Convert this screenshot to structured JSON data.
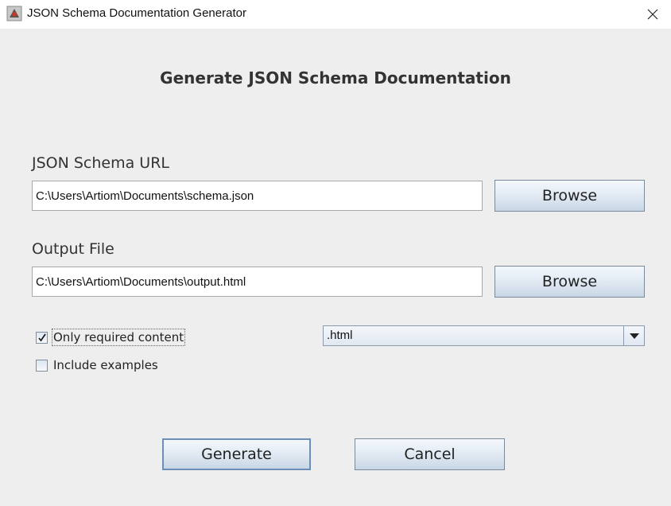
{
  "window": {
    "title": "JSON Schema Documentation Generator",
    "icon": "java-app-icon"
  },
  "heading": "Generate JSON Schema Documentation",
  "schema": {
    "label": "JSON Schema URL",
    "value": "C:\\Users\\Artiom\\Documents\\schema.json",
    "browse_label": "Browse"
  },
  "output": {
    "label": "Output File",
    "value": "C:\\Users\\Artiom\\Documents\\output.html",
    "browse_label": "Browse"
  },
  "options": {
    "only_required": {
      "label": "Only required content",
      "checked": true
    },
    "include_examples": {
      "label": "Include examples",
      "checked": false
    }
  },
  "format": {
    "selected": ".html"
  },
  "actions": {
    "generate_label": "Generate",
    "cancel_label": "Cancel"
  },
  "colors": {
    "background": "#eeeeee",
    "button_top": "#f4f8fc",
    "button_bottom": "#c8d6e5",
    "focus_border": "#6b8fb8"
  }
}
